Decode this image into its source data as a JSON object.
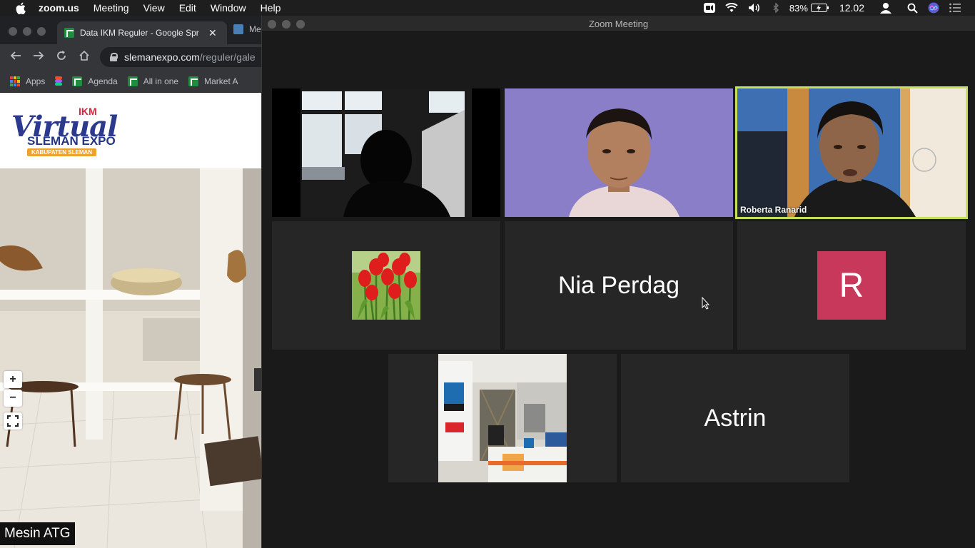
{
  "menubar": {
    "app_name": "zoom.us",
    "items": [
      "Meeting",
      "View",
      "Edit",
      "Window",
      "Help"
    ],
    "battery": "83%",
    "clock": "12.02"
  },
  "browser": {
    "tabs": [
      {
        "label": "Data IKM Reguler - Google Spr"
      },
      {
        "label": "Me"
      }
    ],
    "url": {
      "host": "slemanexpo.com",
      "path": "/reguler/gale"
    },
    "bookmarks": [
      "Apps",
      "Agenda",
      "All in one",
      "Market A"
    ],
    "logo": {
      "ikm": "IKM",
      "virtual": "Virtual",
      "sleman_expo": "SLEMAN EXPO",
      "kabupaten": "KABUPATEN SLEMAN"
    },
    "zoom_in": "+",
    "zoom_out": "−",
    "caption": "Mesin ATG"
  },
  "zoom": {
    "title": "Zoom Meeting",
    "participants": [
      {
        "name": "",
        "type": "video-silhouette"
      },
      {
        "name": "",
        "type": "video-man"
      },
      {
        "name": "Roberta Ranarid",
        "type": "video-active"
      },
      {
        "name": "",
        "type": "profile-tulips"
      },
      {
        "name": "Nia Perdag",
        "type": "name-only"
      },
      {
        "name": "",
        "initial": "R",
        "type": "initial-avatar"
      },
      {
        "name": "",
        "type": "profile-office"
      },
      {
        "name": "Astrin",
        "type": "name-only"
      }
    ]
  },
  "colors": {
    "active_speaker": "#c6e05a",
    "avatar_r": "#c8385a",
    "tile_bg": "#262626"
  }
}
